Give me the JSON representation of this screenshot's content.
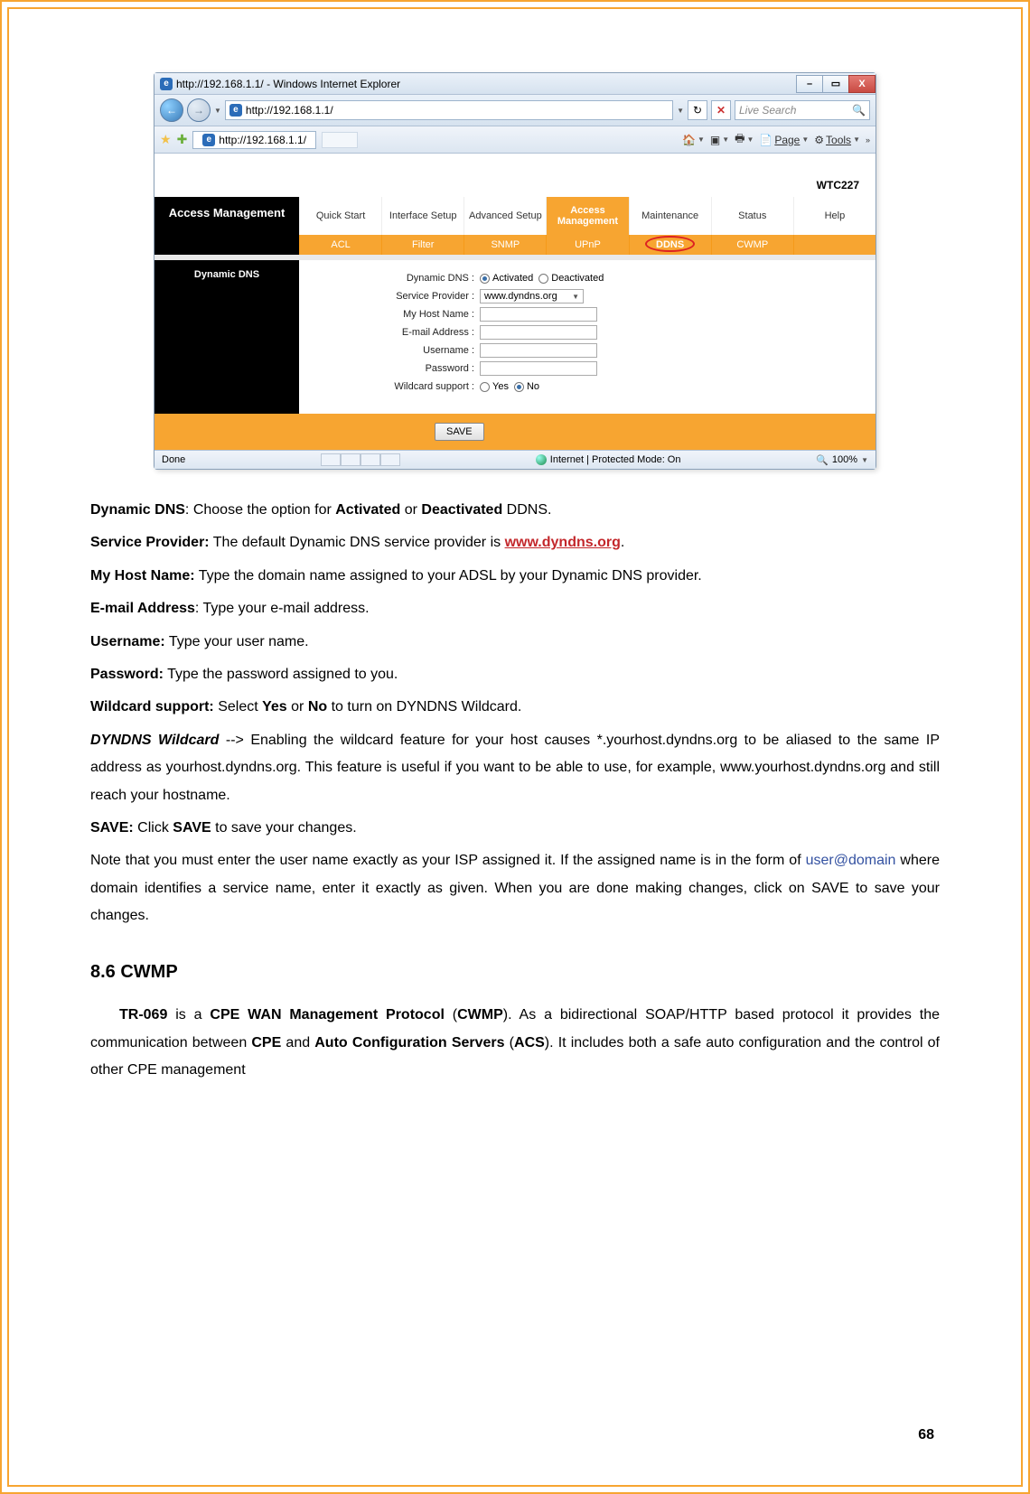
{
  "browser": {
    "title": "http://192.168.1.1/ - Windows Internet Explorer",
    "url": "http://192.168.1.1/",
    "tab_url": "http://192.168.1.1/",
    "search_placeholder": "Live Search",
    "tool_page": "Page",
    "tool_tools": "Tools",
    "status_done": "Done",
    "status_mode": "Internet | Protected Mode: On",
    "zoom": "100%"
  },
  "router": {
    "device": "WTC227",
    "section": "Access Management",
    "topnav": [
      "Quick Start",
      "Interface Setup",
      "Advanced Setup",
      "Access Management",
      "Maintenance",
      "Status",
      "Help"
    ],
    "subnav": [
      "ACL",
      "Filter",
      "SNMP",
      "UPnP",
      "DDNS",
      "CWMP"
    ],
    "panel_title": "Dynamic DNS",
    "form": {
      "dynamic_dns": "Dynamic DNS :",
      "activated": "Activated",
      "deactivated": "Deactivated",
      "service_provider": "Service Provider :",
      "provider_value": "www.dyndns.org",
      "my_host": "My Host Name :",
      "email": "E-mail Address :",
      "username": "Username :",
      "password": "Password :",
      "wildcard": "Wildcard support :",
      "yes": "Yes",
      "no": "No"
    },
    "save": "SAVE"
  },
  "doc": {
    "p1_b": "Dynamic DNS",
    "p1": ": Choose the option for ",
    "p1_b2": "Activated",
    "p1_mid": " or ",
    "p1_b3": "Deactivated",
    "p1_end": " DDNS.",
    "p2_b": "Service Provider:",
    "p2": " The default Dynamic DNS service provider is ",
    "p2_link": "www.dyndns.org",
    "p2_end": ".",
    "p3_b": "My Host Name:",
    "p3": " Type the domain name assigned to your ADSL by your Dynamic DNS provider.",
    "p4_b": "E-mail Address",
    "p4": ": Type your e-mail address.",
    "p5_b": "Username:",
    "p5": " Type your user name.",
    "p6_b": "Password:",
    "p6": " Type the password assigned to you.",
    "p7_b": "Wildcard support:",
    "p7": " Select ",
    "p7_b2": "Yes",
    "p7_mid": " or ",
    "p7_b3": "No",
    "p7_end": " to turn on DYNDNS Wildcard.",
    "p8_b": "DYNDNS Wildcard",
    "p8": " --> Enabling the wildcard feature for your host causes *.yourhost.dyndns.org to be aliased to the same IP address as yourhost.dyndns.org. This feature is useful if you want to be able to use, for example, www.yourhost.dyndns.org and still reach your hostname.",
    "p9_b": "SAVE:",
    "p9_mid1": " Click ",
    "p9_b2": "SAVE",
    "p9_end": " to save your changes.",
    "p10a": "Note that you must enter the user name exactly as your ISP assigned it. If the assigned name is in the form of ",
    "p10_link": "user@domain",
    "p10b": " where domain identifies a service name, enter it exactly as given. When you are done making changes, click on SAVE to save your changes.",
    "section": "8.6 CWMP",
    "p11a": "TR-069",
    "p11b": " is a ",
    "p11c": "CPE WAN Management Protocol",
    "p11d": " (",
    "p11e": "CWMP",
    "p11f": "). As a bidirectional SOAP/HTTP based protocol it provides the communication between ",
    "p11g": "CPE",
    "p11h": " and ",
    "p11i": "Auto Configuration Servers",
    "p11j": " (",
    "p11k": "ACS",
    "p11l": "). It includes both a safe auto configuration and the control of other CPE management"
  },
  "page_number": "68"
}
